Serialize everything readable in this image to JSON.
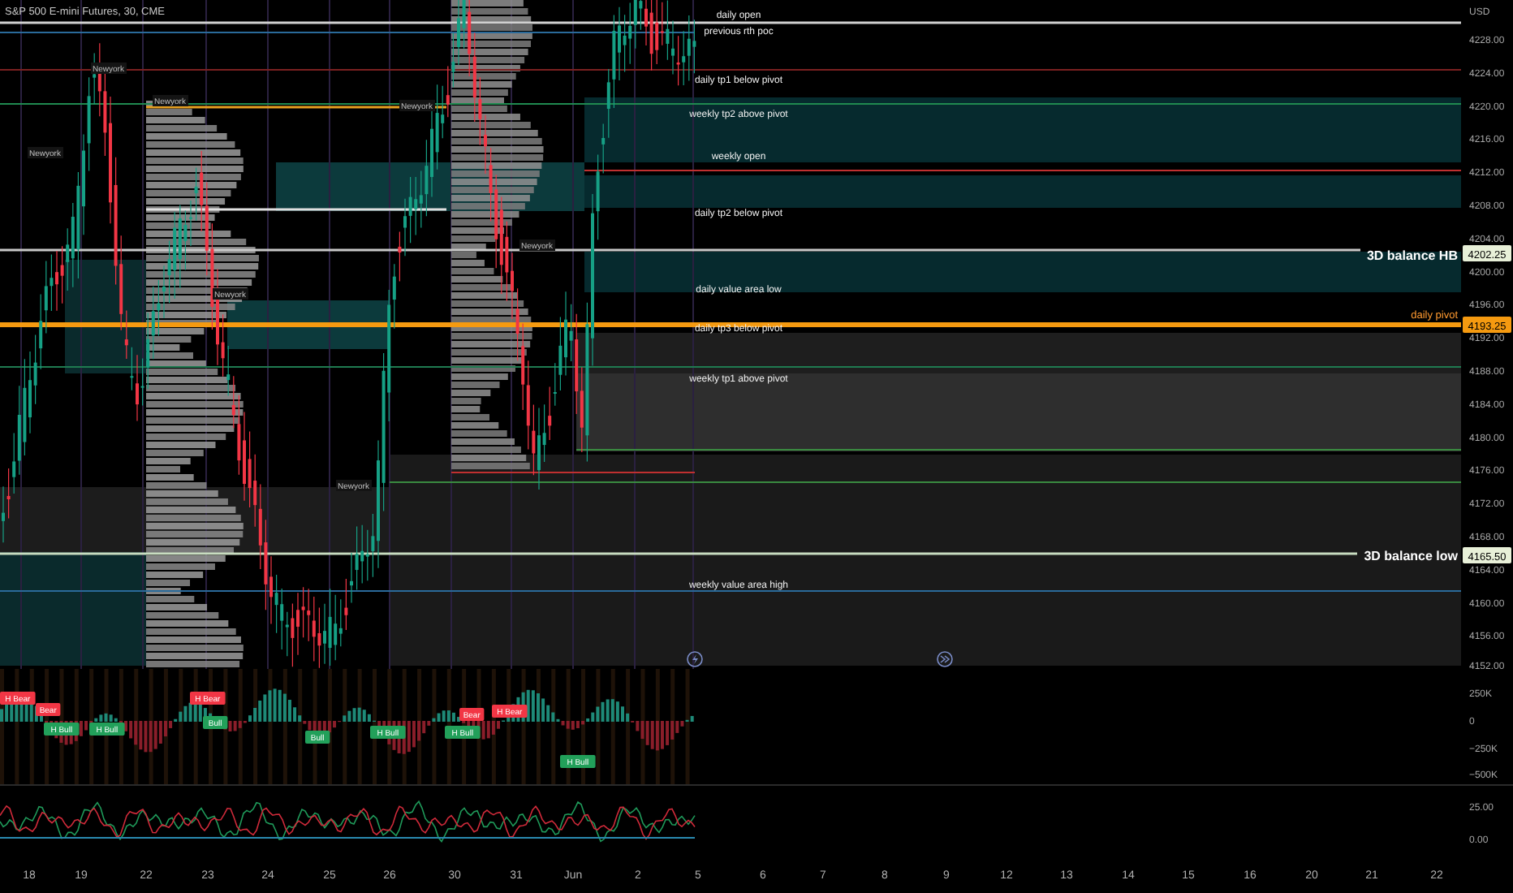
{
  "header": {
    "title": "S&P 500 E-mini Futures, 30, CME"
  },
  "price_axis": {
    "currency": "USD",
    "ticks": [
      "4228.00",
      "4224.00",
      "4220.00",
      "4216.00",
      "4212.00",
      "4208.00",
      "4204.00",
      "4200.00",
      "4196.00",
      "4192.00",
      "4188.00",
      "4184.00",
      "4180.00",
      "4176.00",
      "4172.00",
      "4168.00",
      "4164.00",
      "4160.00",
      "4156.00",
      "4152.00"
    ]
  },
  "levels": [
    {
      "label": "daily open",
      "kind": "note"
    },
    {
      "label": "previous rth poc",
      "kind": "note"
    },
    {
      "label": "daily tp1 below pivot",
      "kind": "note"
    },
    {
      "label": "weekly tp2 above pivot",
      "kind": "note"
    },
    {
      "label": "weekly open",
      "kind": "note"
    },
    {
      "label": "daily tp2 below pivot",
      "kind": "note"
    },
    {
      "label": "3D balance HB",
      "kind": "balance",
      "price_tag": "4202.25"
    },
    {
      "label": "daily value area low",
      "kind": "note"
    },
    {
      "label": "daily tp3 below pivot",
      "kind": "note"
    },
    {
      "label": "daily pivot",
      "kind": "pivot",
      "price_tag": "4193.25"
    },
    {
      "label": "weekly tp1 above pivot",
      "kind": "note"
    },
    {
      "label": "3D balance low",
      "kind": "balance",
      "price_tag": "4165.50"
    },
    {
      "label": "weekly value area high",
      "kind": "note"
    }
  ],
  "session_labels": [
    "Newyork",
    "Newyork",
    "Newyork",
    "Newyork",
    "Newyork",
    "Newyork",
    "Newyork"
  ],
  "delta_pane": {
    "ticks": [
      "250K",
      "0",
      "−250K",
      "−500K"
    ],
    "signals": [
      {
        "label": "H Bear",
        "kind": "bear"
      },
      {
        "label": "Bear",
        "kind": "bear"
      },
      {
        "label": "H Bull",
        "kind": "bull"
      },
      {
        "label": "H Bull",
        "kind": "bull"
      },
      {
        "label": "H Bear",
        "kind": "bear"
      },
      {
        "label": "Bull",
        "kind": "bull"
      },
      {
        "label": "Bull",
        "kind": "bull"
      },
      {
        "label": "H Bull",
        "kind": "bull"
      },
      {
        "label": "H Bull",
        "kind": "bull"
      },
      {
        "label": "Bear",
        "kind": "bear"
      },
      {
        "label": "H Bear",
        "kind": "bear"
      },
      {
        "label": "H Bull",
        "kind": "bull"
      }
    ]
  },
  "oscillator_pane": {
    "ticks": [
      "25.00",
      "0.00"
    ]
  },
  "time_axis": {
    "ticks": [
      "18",
      "19",
      "22",
      "23",
      "24",
      "25",
      "26",
      "30",
      "31",
      "Jun",
      "2",
      "5",
      "6",
      "7",
      "8",
      "9",
      "12",
      "13",
      "14",
      "15",
      "16",
      "20",
      "21",
      "22"
    ]
  }
}
